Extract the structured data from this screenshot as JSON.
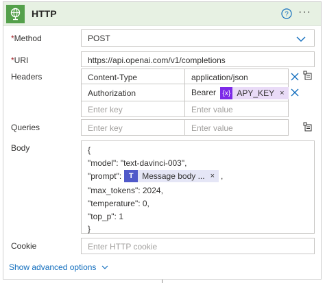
{
  "header": {
    "title": "HTTP",
    "icon": "globe-icon",
    "help_icon": "help-circle-icon",
    "more_icon": "more-options-icon",
    "more_text": "···",
    "accent": "#54a04b",
    "background": "#e7f1e3"
  },
  "method": {
    "required_mark": "*",
    "label": "Method",
    "value": "POST"
  },
  "uri": {
    "required_mark": "*",
    "label": "URI",
    "value": "https://api.openai.com/v1/completions"
  },
  "headers": {
    "label": "Headers",
    "rows": [
      {
        "key": "Content-Type",
        "value_text": "application/json"
      },
      {
        "key": "Authorization",
        "value_prefix": "Bearer",
        "token_icon_text": "{x}",
        "token_label": "APY_KEY",
        "token_remove": "×"
      }
    ],
    "key_placeholder": "Enter key",
    "value_placeholder": "Enter value"
  },
  "queries": {
    "label": "Queries",
    "key_placeholder": "Enter key",
    "value_placeholder": "Enter value"
  },
  "body": {
    "label": "Body",
    "lines": {
      "open": "{",
      "model": "\"model\": \"text-davinci-003\",",
      "prompt_prefix": "\"prompt\":",
      "prompt_token_label": "Message body ...",
      "prompt_token_remove": "×",
      "prompt_suffix": ",",
      "max_tokens": "\"max_tokens\": 2024,",
      "temperature": "\"temperature\": 0,",
      "top_p": "\"top_p\": 1",
      "close": "}"
    }
  },
  "cookie": {
    "label": "Cookie",
    "placeholder": "Enter HTTP cookie"
  },
  "advanced": {
    "label": "Show advanced options"
  },
  "colors": {
    "link": "#0f6cbd",
    "dynamic_token": "#7d2ae8",
    "dynamic_token_bg": "#e9dbf7",
    "teams_token": "#5059c9",
    "required": "#a4262c"
  }
}
